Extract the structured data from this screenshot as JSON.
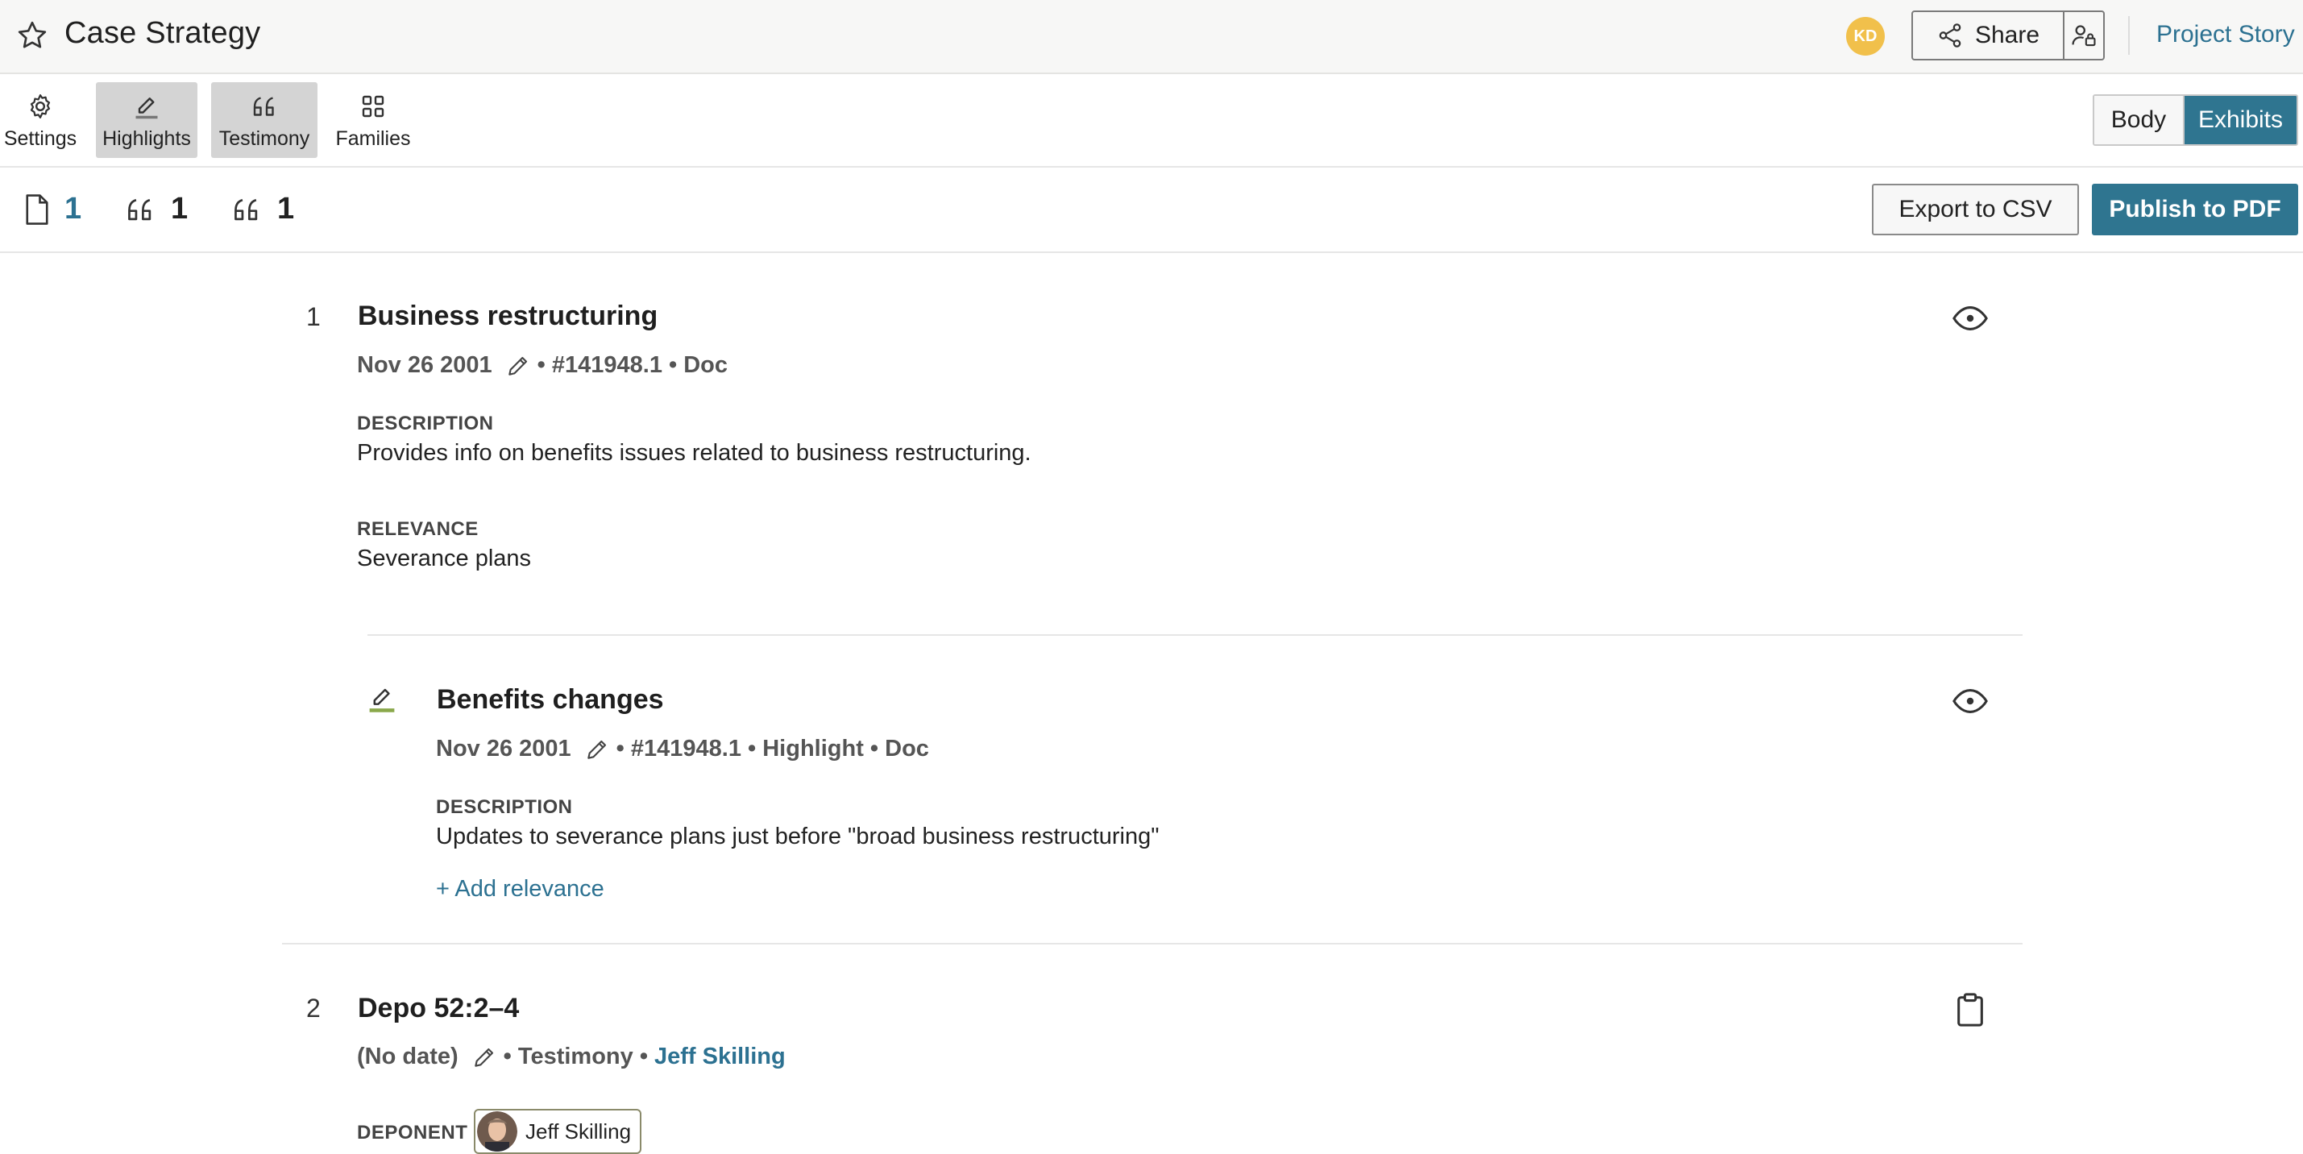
{
  "header": {
    "title": "Case Strategy",
    "avatar_initials": "KD",
    "share_label": "Share",
    "project_story_label": "Project Story"
  },
  "toolbar": {
    "tools": [
      {
        "label": "Settings",
        "icon": "gear-icon",
        "active": false
      },
      {
        "label": "Highlights",
        "icon": "highlighter-icon",
        "active": true
      },
      {
        "label": "Testimony",
        "icon": "quote-icon",
        "active": true
      },
      {
        "label": "Families",
        "icon": "grid-icon",
        "active": false
      }
    ],
    "view_toggle": {
      "body": "Body",
      "exhibits": "Exhibits",
      "selected": "Exhibits"
    }
  },
  "counts": {
    "documents": "1",
    "quotes_a": "1",
    "quotes_b": "1",
    "export_csv_label": "Export to CSV",
    "publish_pdf_label": "Publish to PDF"
  },
  "items": [
    {
      "number": "1",
      "title": "Business restructuring",
      "date": "Nov 26 2001",
      "meta": "• #141948.1 • Doc",
      "description_label": "DESCRIPTION",
      "description": "Provides info on benefits issues related to business restructuring.",
      "relevance_label": "RELEVANCE",
      "relevance": "Severance plans",
      "sub": {
        "title": "Benefits changes",
        "date": "Nov 26 2001",
        "meta": "• #141948.1 • Highlight • Doc",
        "description_label": "DESCRIPTION",
        "description": "Updates to severance plans just before \"broad business restructuring\"",
        "add_relevance": "+ Add relevance"
      }
    },
    {
      "number": "2",
      "title": "Depo 52:2–4",
      "date": "(No date)",
      "meta": "• Testimony •",
      "deponent_link": "Jeff Skilling",
      "deponent_label": "DEPONENT",
      "deponent_name": "Jeff Skilling"
    }
  ],
  "colors": {
    "accent": "#2f7590",
    "link": "#2c7191",
    "highlight": "#8aa84b",
    "avatar": "#f1c04b"
  }
}
